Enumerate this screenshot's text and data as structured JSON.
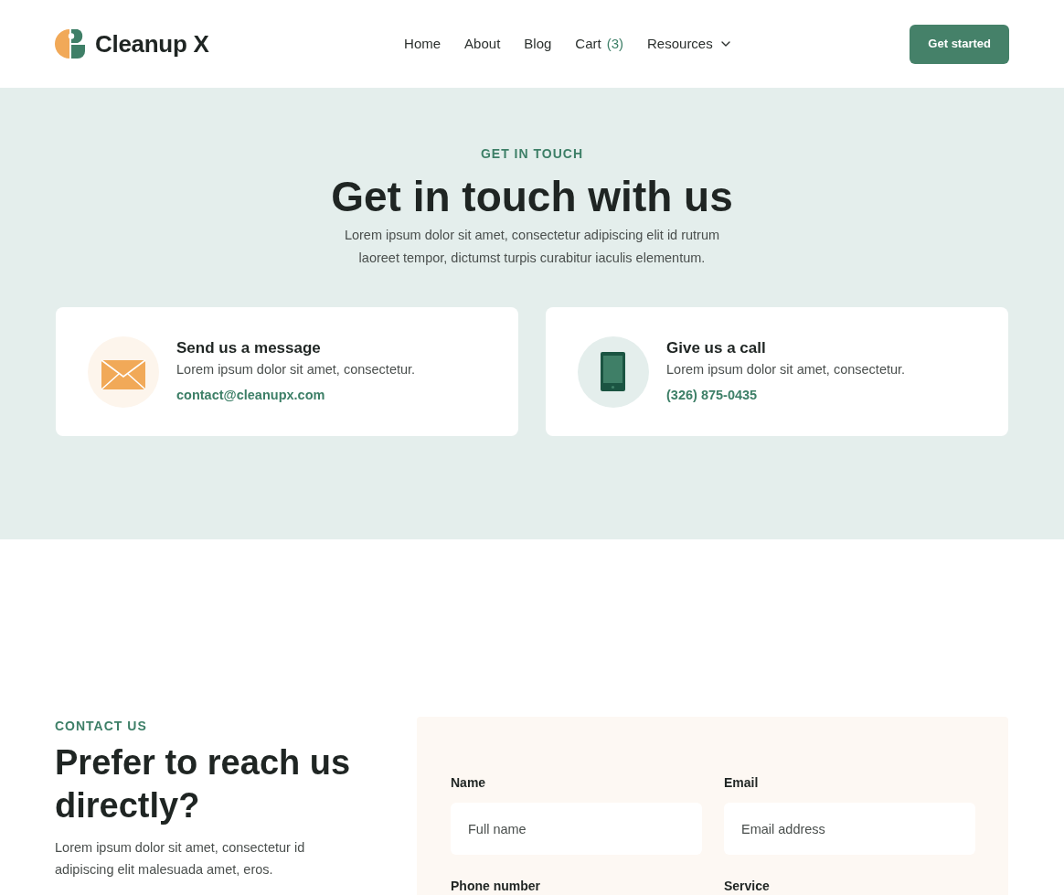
{
  "header": {
    "logo": {
      "text": "Cleanup X"
    },
    "nav": [
      {
        "label": "Home",
        "dropdown": false
      },
      {
        "label": "About",
        "dropdown": false
      },
      {
        "label": "Blog",
        "dropdown": false
      },
      {
        "label": "Cart",
        "count": "(3)",
        "dropdown": false
      },
      {
        "label": "Resources",
        "dropdown": true
      }
    ],
    "cta": "Get started"
  },
  "hero": {
    "eyebrow": "GET IN TOUCH",
    "title": "Get in touch with us",
    "text": "Lorem ipsum dolor sit amet, consectetur adipiscing elit id rutrum laoreet tempor, dictumst turpis curabitur iaculis elementum.",
    "cards": [
      {
        "kind": "email",
        "title": "Send us a message",
        "text": "Lorem ipsum dolor sit amet, consectetur.",
        "link": "contact@cleanupx.com"
      },
      {
        "kind": "phone",
        "title": "Give us a call",
        "text": "Lorem ipsum dolor sit amet, consectetur.",
        "link": "(326) 875-0435"
      }
    ]
  },
  "contact": {
    "eyebrow": "CONTACT US",
    "title": "Prefer to reach us directly?",
    "text": "Lorem ipsum dolor sit amet, consectetur id adipiscing elit malesuada amet, eros.",
    "form": {
      "fields": [
        {
          "label": "Name",
          "placeholder": "Full name"
        },
        {
          "label": "Email",
          "placeholder": "Email address"
        },
        {
          "label": "Phone number"
        },
        {
          "label": "Service"
        }
      ]
    }
  }
}
